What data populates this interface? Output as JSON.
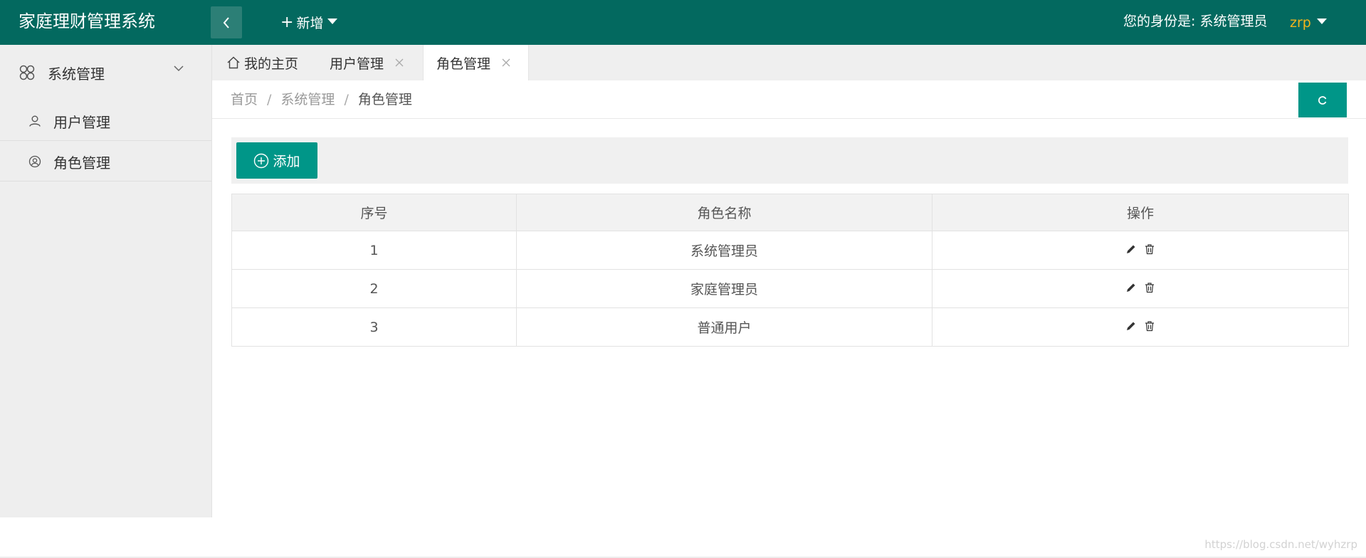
{
  "header": {
    "app_title": "家庭理财管理系统",
    "new_menu_label": "新增",
    "identity_text": "您的身份是: 系统管理员",
    "username": "zrp"
  },
  "sidebar": {
    "group": {
      "label": "系统管理",
      "icon": "cluster-icon"
    },
    "items": [
      {
        "label": "用户管理",
        "icon": "user-icon"
      },
      {
        "label": "角色管理",
        "icon": "user-circle-icon"
      }
    ]
  },
  "tabs": [
    {
      "label": "我的主页",
      "icon": "home-icon",
      "closable": false,
      "active": false
    },
    {
      "label": "用户管理",
      "closable": true,
      "active": false
    },
    {
      "label": "角色管理",
      "closable": true,
      "active": true
    }
  ],
  "breadcrumb": {
    "items": [
      "首页",
      "系统管理",
      "角色管理"
    ],
    "separator": "/"
  },
  "toolbar": {
    "add_label": "添加"
  },
  "table": {
    "columns": [
      "序号",
      "角色名称",
      "操作"
    ],
    "rows": [
      {
        "id": "1",
        "name": "系统管理员"
      },
      {
        "id": "2",
        "name": "家庭管理员"
      },
      {
        "id": "3",
        "name": "普通用户"
      }
    ]
  },
  "colors": {
    "header_bg": "#03695f",
    "accent": "#009688",
    "username": "#f2b41c"
  },
  "watermark": "https://blog.csdn.net/wyhzrp"
}
